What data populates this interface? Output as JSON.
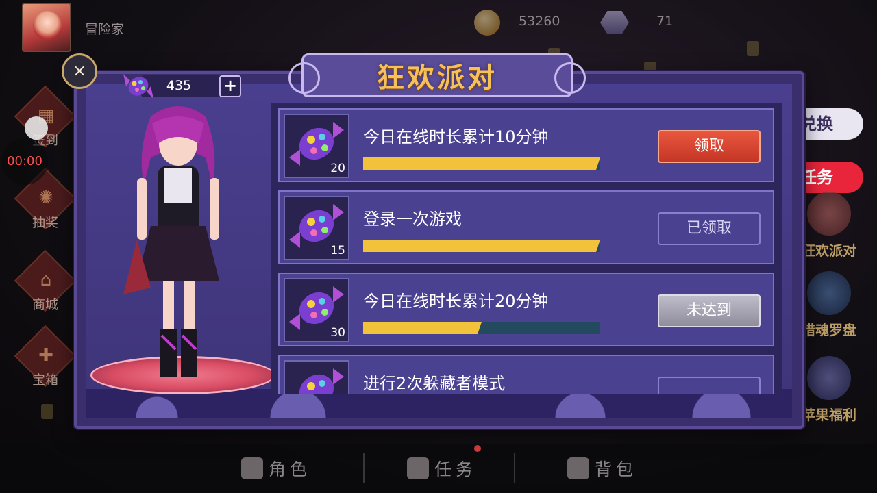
{
  "topbar": {
    "player_name": "冒险家",
    "coins": "53260",
    "gems": "71"
  },
  "timer": "00:00",
  "side_menu": [
    {
      "label": "签到",
      "icon": "calendar-icon"
    },
    {
      "label": "抽奖",
      "icon": "wheel-icon"
    },
    {
      "label": "商城",
      "icon": "shop-icon"
    },
    {
      "label": "宝箱",
      "icon": "gift-icon"
    }
  ],
  "right_menu": {
    "exchange": "兑换",
    "task": "任务",
    "items": [
      "狂欢派对",
      "猎魂罗盘",
      "苹果福利"
    ]
  },
  "dialog": {
    "title": "狂欢派对",
    "close": "×",
    "candy_count": "435",
    "plus": "+"
  },
  "tasks": [
    {
      "title": "今日在线时长累计10分钟",
      "qty": "20",
      "progress": 1.0,
      "button": "领取",
      "state": "claim"
    },
    {
      "title": "登录一次游戏",
      "qty": "15",
      "progress": 1.0,
      "button": "已领取",
      "state": "claimed"
    },
    {
      "title": "今日在线时长累计20分钟",
      "qty": "30",
      "progress": 0.5,
      "button": "未达到",
      "state": "notyet"
    },
    {
      "title": "进行2次躲藏者模式",
      "qty": "",
      "progress": 0,
      "button": "",
      "state": "claimed"
    }
  ],
  "bottom_nav": [
    {
      "label": "角色",
      "icon": "character-icon"
    },
    {
      "label": "任务",
      "icon": "task-icon"
    },
    {
      "label": "背包",
      "icon": "backpack-icon"
    }
  ],
  "colors": {
    "dialog_bg": "#3a2f6c",
    "title_gold": "#f7c15a",
    "progress_fill": "#f2c23a",
    "claim_red": "#e8563e",
    "task_red": "#e8253b"
  }
}
